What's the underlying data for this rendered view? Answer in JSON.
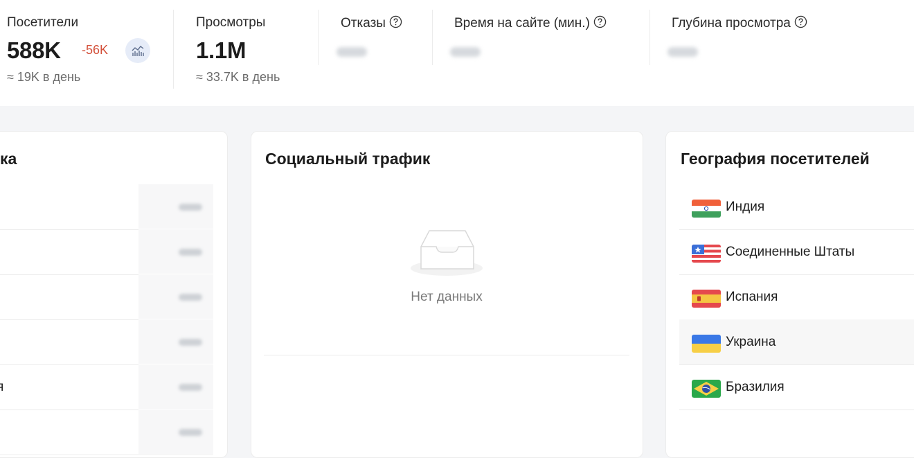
{
  "stats": {
    "visitors": {
      "label": "Посетители",
      "value": "588K",
      "delta": "-56K",
      "sub": "≈ 19K в день"
    },
    "views": {
      "label": "Просмотры",
      "value": "1.1M",
      "sub": "≈ 33.7K в день"
    },
    "bounces": {
      "label": "Отказы"
    },
    "time_on_site": {
      "label": "Время на сайте (мин.)"
    },
    "view_depth": {
      "label": "Глубина просмотра"
    }
  },
  "cards": {
    "left": {
      "title_fragment": "ка",
      "row_fragment": "я",
      "row_count": 6
    },
    "social": {
      "title": "Социальный трафик",
      "empty_text": "Нет данных"
    },
    "geography": {
      "title": "География посетителей",
      "countries": [
        {
          "name": "Индия",
          "flag": "india-flag-icon"
        },
        {
          "name": "Соединенные Штаты",
          "flag": "usa-flag-icon"
        },
        {
          "name": "Испания",
          "flag": "spain-flag-icon"
        },
        {
          "name": "Украина",
          "flag": "ukraine-flag-icon"
        },
        {
          "name": "Бразилия",
          "flag": "brazil-flag-icon"
        }
      ]
    }
  },
  "colors": {
    "delta_negative": "#d3503a",
    "trend_button_bg": "#e6ecf8",
    "page_bg": "#f4f5f7"
  }
}
